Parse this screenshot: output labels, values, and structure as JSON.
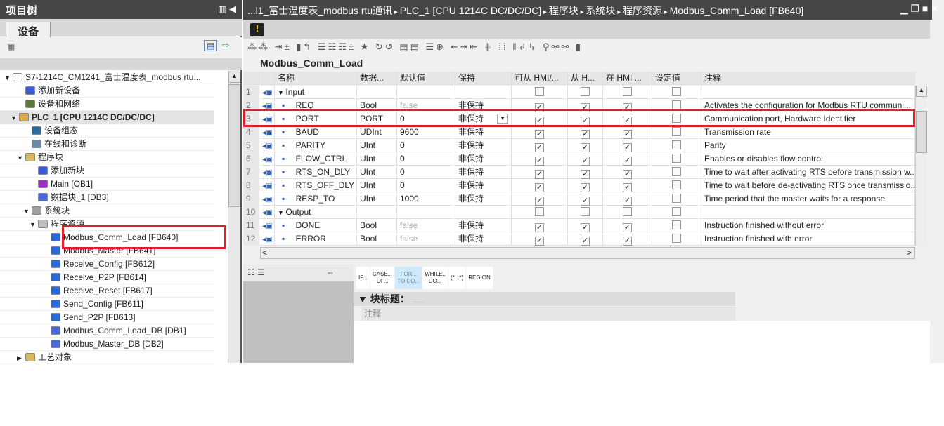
{
  "left": {
    "title": "项目树",
    "tab": "设备",
    "tree": [
      {
        "label": "S7-1214C_CM1241_富士温度表_modbus rtu...",
        "level": 0,
        "tw": "▼",
        "color": "#ffffff"
      },
      {
        "label": "添加新设备",
        "level": 2,
        "tw": "",
        "color": "#3a5bd8"
      },
      {
        "label": "设备和网络",
        "level": 2,
        "tw": "",
        "color": "#5a7a3a"
      },
      {
        "label": "PLC_1 [CPU 1214C DC/DC/DC]",
        "level": 1,
        "tw": "▼",
        "color": "#d8a84a",
        "bold": true
      },
      {
        "label": "设备组态",
        "level": 3,
        "tw": "",
        "color": "#2a6a9a"
      },
      {
        "label": "在线和诊断",
        "level": 3,
        "tw": "",
        "color": "#6a8aaa"
      },
      {
        "label": "程序块",
        "level": 2,
        "tw": "▼",
        "color": "#d8b860"
      },
      {
        "label": "添加新块",
        "level": 4,
        "tw": "",
        "color": "#3a5bd8"
      },
      {
        "label": "Main [OB1]",
        "level": 4,
        "tw": "",
        "color": "#9a30c8"
      },
      {
        "label": "数据块_1 [DB3]",
        "level": 4,
        "tw": "",
        "color": "#4a6ad8"
      },
      {
        "label": "系统块",
        "level": 3,
        "tw": "▼",
        "color": "#a0a0a0"
      },
      {
        "label": "程序资源",
        "level": 4,
        "tw": "▼",
        "color": "#c0c0c0"
      },
      {
        "label": "Modbus_Comm_Load [FB640]",
        "level": 6,
        "tw": "",
        "color": "#2a6ad8"
      },
      {
        "label": "Modbus_Master [FB641]",
        "level": 6,
        "tw": "",
        "color": "#2a6ad8"
      },
      {
        "label": "Receive_Config [FB612]",
        "level": 6,
        "tw": "",
        "color": "#2a6ad8"
      },
      {
        "label": "Receive_P2P [FB614]",
        "level": 6,
        "tw": "",
        "color": "#2a6ad8"
      },
      {
        "label": "Receive_Reset [FB617]",
        "level": 6,
        "tw": "",
        "color": "#2a6ad8"
      },
      {
        "label": "Send_Config [FB611]",
        "level": 6,
        "tw": "",
        "color": "#2a6ad8"
      },
      {
        "label": "Send_P2P [FB613]",
        "level": 6,
        "tw": "",
        "color": "#2a6ad8"
      },
      {
        "label": "Modbus_Comm_Load_DB [DB1]",
        "level": 6,
        "tw": "",
        "color": "#4a6ad8"
      },
      {
        "label": "Modbus_Master_DB [DB2]",
        "level": 6,
        "tw": "",
        "color": "#4a6ad8"
      },
      {
        "label": "工艺对象",
        "level": 2,
        "tw": "▶",
        "color": "#d8b860"
      }
    ]
  },
  "breadcrumb": [
    "...l1_富士温度表_modbus rtu通讯",
    "PLC_1 [CPU 1214C DC/DC/DC]",
    "程序块",
    "系统块",
    "程序资源",
    "Modbus_Comm_Load [FB640]"
  ],
  "block_name": "Modbus_Comm_Load",
  "columns": [
    "",
    "",
    "名称",
    "数据...",
    "默认值",
    "保持",
    "可从 HMI/...",
    "从 H...",
    "在 HMI ...",
    "设定值",
    "注释"
  ],
  "rows": [
    {
      "n": "1",
      "section": true,
      "name": "Input"
    },
    {
      "n": "2",
      "name": "REQ",
      "type": "Bool",
      "def": "false",
      "ret": "非保持",
      "c": [
        true,
        true,
        true
      ],
      "comment": "Activates the configuration for Modbus RTU communi..."
    },
    {
      "n": "3",
      "name": "PORT",
      "type": "PORT",
      "def": "0",
      "ret": "非保持",
      "c": [
        true,
        true,
        true
      ],
      "comment": "Communication port, Hardware Identifier"
    },
    {
      "n": "4",
      "name": "BAUD",
      "type": "UDInt",
      "def": "9600",
      "ret": "非保持",
      "c": [
        true,
        true,
        true
      ],
      "comment": "Transmission rate"
    },
    {
      "n": "5",
      "name": "PARITY",
      "type": "UInt",
      "def": "0",
      "ret": "非保持",
      "c": [
        true,
        true,
        true
      ],
      "comment": "Parity"
    },
    {
      "n": "6",
      "name": "FLOW_CTRL",
      "type": "UInt",
      "def": "0",
      "ret": "非保持",
      "c": [
        true,
        true,
        true
      ],
      "comment": "Enables or disables flow control"
    },
    {
      "n": "7",
      "name": "RTS_ON_DLY",
      "type": "UInt",
      "def": "0",
      "ret": "非保持",
      "c": [
        true,
        true,
        true
      ],
      "comment": "Time to wait after activating RTS before transmission w..."
    },
    {
      "n": "8",
      "name": "RTS_OFF_DLY",
      "type": "UInt",
      "def": "0",
      "ret": "非保持",
      "c": [
        true,
        true,
        true
      ],
      "comment": "Time to wait before de-activating RTS once transmissio..."
    },
    {
      "n": "9",
      "name": "RESP_TO",
      "type": "UInt",
      "def": "1000",
      "ret": "非保持",
      "c": [
        true,
        true,
        true
      ],
      "comment": "Time period that the master waits for a response"
    },
    {
      "n": "10",
      "section": true,
      "name": "Output"
    },
    {
      "n": "11",
      "name": "DONE",
      "type": "Bool",
      "def": "false",
      "ret": "非保持",
      "c": [
        true,
        true,
        true
      ],
      "comment": "Instruction finished without error"
    },
    {
      "n": "12",
      "name": "ERROR",
      "type": "Bool",
      "def": "false",
      "ret": "非保持",
      "c": [
        true,
        true,
        true
      ],
      "comment": "Instruction finished with error"
    }
  ],
  "statements": [
    [
      "IF..."
    ],
    [
      "CASE...",
      "OF..."
    ],
    [
      "FOR...",
      "TO DO..."
    ],
    [
      "WHILE..",
      "DO..."
    ],
    [
      "(*...*)"
    ],
    [
      "REGION"
    ]
  ],
  "block_title_label": "块标题：",
  "block_title_value": "......",
  "comment_placeholder": "注释",
  "highlight_color": "#e0202a"
}
